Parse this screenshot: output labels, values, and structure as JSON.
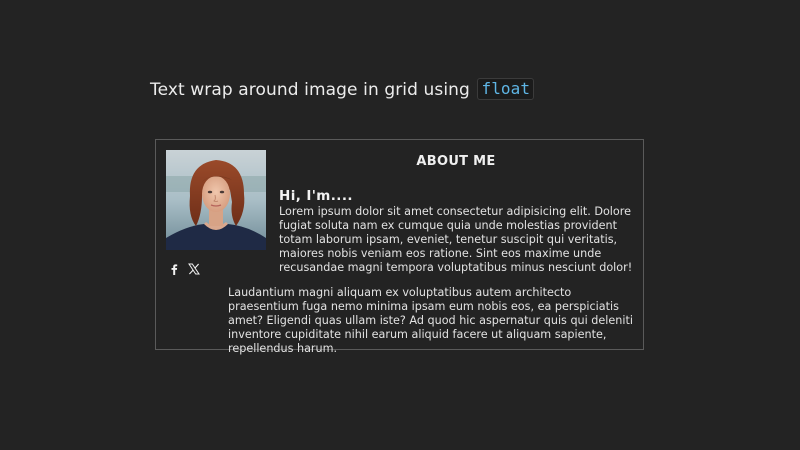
{
  "page": {
    "heading_text": "Text wrap around image in grid using",
    "heading_code": "float"
  },
  "card": {
    "title": "ABOUT ME",
    "greeting": "Hi, I'm....",
    "paragraph_1": "Lorem ipsum dolor sit amet consectetur adipisicing elit. Dolore fugiat soluta nam ex cumque quia unde molestias provident totam laborum ipsam, eveniet, tenetur suscipit qui veritatis, maiores nobis veniam eos ratione. Sint eos maxime unde recusandae magni tempora voluptatibus minus nesciunt dolor!",
    "paragraph_2": "Laudantium magni aliquam ex voluptatibus autem architecto praesentium fuga nemo minima ipsam eum nobis eos, ea perspiciatis amet? Eligendi quas ullam iste? Ad quod hic aspernatur quis qui deleniti inventore cupiditate nihil earum aliquid facere ut aliquam sapiente, repellendus harum.",
    "social_icons": [
      "facebook-icon",
      "x-icon"
    ]
  },
  "colors": {
    "background": "#232323",
    "code_text": "#5fb6e6",
    "card_border": "#5a5a5a"
  }
}
